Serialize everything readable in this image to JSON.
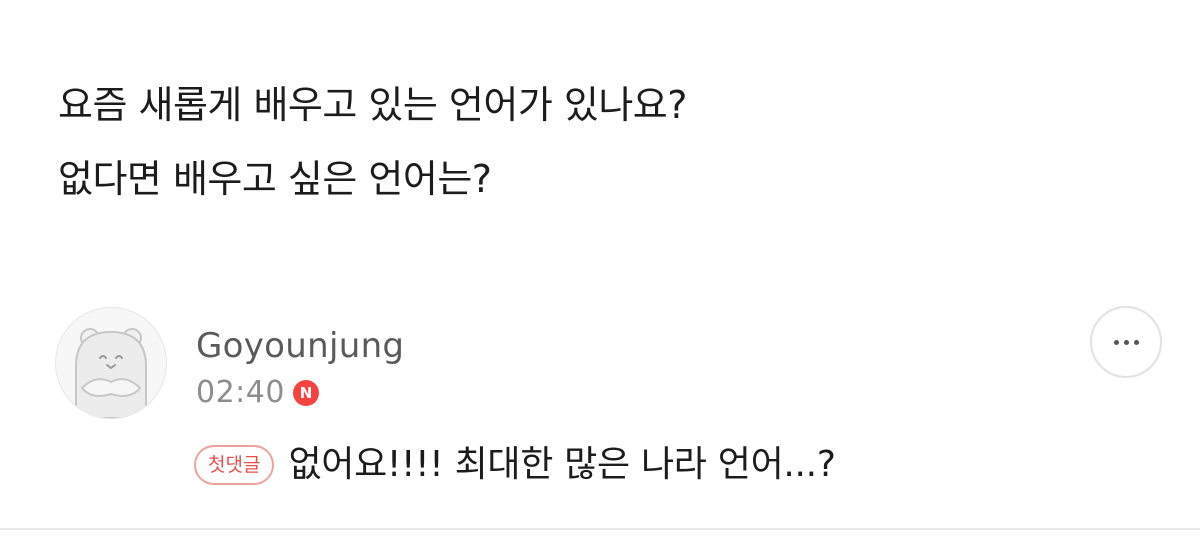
{
  "question": {
    "line1": "요즘 새롭게 배우고 있는 언어가 있나요?",
    "line2": "없다면 배우고 싶은 언어는?"
  },
  "comment": {
    "author": "Goyounjung",
    "time": "02:40",
    "new_badge": "N",
    "first_comment_tag": "첫댓글",
    "text": "없어요!!!! 최대한 많은 나라 언어...?"
  },
  "icons": {
    "avatar": "hamster-avatar-icon",
    "more": "more-dots-icon"
  },
  "colors": {
    "badge_red": "#f5433f",
    "tag_text": "#e8504c",
    "tag_border": "#f0a19e",
    "meta_gray": "#8d8d8d"
  }
}
